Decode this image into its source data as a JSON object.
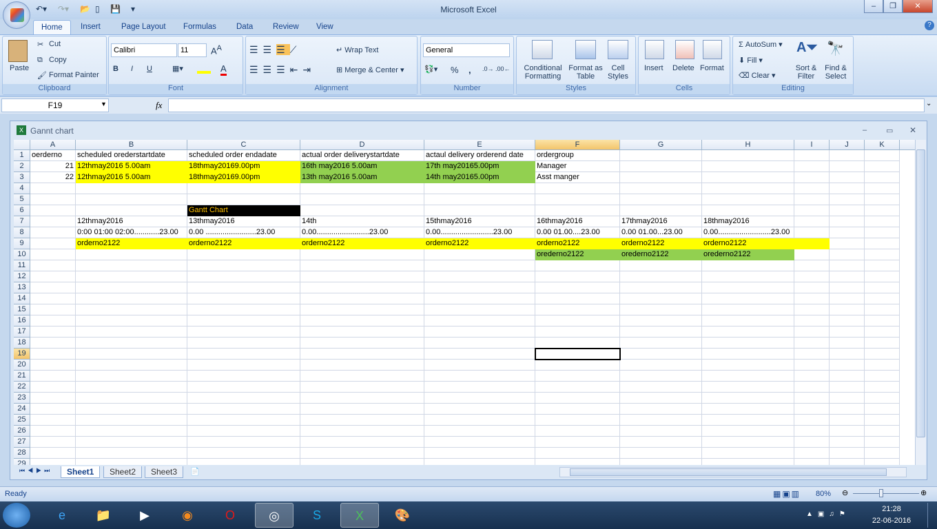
{
  "app": {
    "title": "Microsoft Excel"
  },
  "ribbon": {
    "tabs": [
      "Home",
      "Insert",
      "Page Layout",
      "Formulas",
      "Data",
      "Review",
      "View"
    ],
    "clipboard": {
      "label": "Clipboard",
      "paste": "Paste",
      "cut": "Cut",
      "copy": "Copy",
      "format_painter": "Format Painter"
    },
    "font": {
      "label": "Font",
      "name": "Calibri",
      "size": "11",
      "bold": "B",
      "italic": "I",
      "underline": "U"
    },
    "alignment": {
      "label": "Alignment",
      "wrap": "Wrap Text",
      "merge": "Merge & Center"
    },
    "number": {
      "label": "Number",
      "format": "General",
      "percent": "%",
      "comma": ","
    },
    "styles": {
      "label": "Styles",
      "conditional": "Conditional Formatting",
      "format_table": "Format as Table",
      "cell_styles": "Cell Styles"
    },
    "cells": {
      "label": "Cells",
      "insert": "Insert",
      "delete": "Delete",
      "format": "Format"
    },
    "editing": {
      "label": "Editing",
      "autosum": "AutoSum",
      "fill": "Fill",
      "clear": "Clear",
      "sort": "Sort & Filter",
      "find": "Find & Select"
    }
  },
  "formula_bar": {
    "name_box": "F19",
    "fx": "fx",
    "value": ""
  },
  "workbook": {
    "title": "Gannt chart"
  },
  "colors": {
    "yellow": "#ffff00",
    "green": "#92d050",
    "black": "#000000",
    "orange_text": "#ffc000"
  },
  "columns": [
    "A",
    "B",
    "C",
    "D",
    "E",
    "F",
    "G",
    "H",
    "I",
    "J",
    "K"
  ],
  "row_count": 29,
  "selected_cell": {
    "col": "F",
    "row": 19
  },
  "cells": [
    {
      "r": 1,
      "c": "A",
      "v": "oerderno"
    },
    {
      "r": 1,
      "c": "B",
      "v": "scheduled orederstartdate"
    },
    {
      "r": 1,
      "c": "C",
      "v": "scheduled order endadate"
    },
    {
      "r": 1,
      "c": "D",
      "v": "actual order deliverystartdate"
    },
    {
      "r": 1,
      "c": "E",
      "v": "actaul delivery orderend date"
    },
    {
      "r": 1,
      "c": "F",
      "v": "ordergroup"
    },
    {
      "r": 2,
      "c": "A",
      "v": "21",
      "num": true
    },
    {
      "r": 2,
      "c": "B",
      "v": "12thmay2016 5.00am",
      "fill": "yellow"
    },
    {
      "r": 2,
      "c": "C",
      "v": "18thmay20169.00pm",
      "fill": "yellow"
    },
    {
      "r": 2,
      "c": "D",
      "v": "16th may2016 5.00am",
      "fill": "green"
    },
    {
      "r": 2,
      "c": "E",
      "v": "17th may20165.00pm",
      "fill": "green"
    },
    {
      "r": 2,
      "c": "F",
      "v": "Manager"
    },
    {
      "r": 3,
      "c": "A",
      "v": "22",
      "num": true
    },
    {
      "r": 3,
      "c": "B",
      "v": "12thmay2016 5.00am",
      "fill": "yellow"
    },
    {
      "r": 3,
      "c": "C",
      "v": "18thmay20169.00pm",
      "fill": "yellow"
    },
    {
      "r": 3,
      "c": "D",
      "v": "13th may2016 5.00am",
      "fill": "green"
    },
    {
      "r": 3,
      "c": "E",
      "v": "14th may20165.00pm",
      "fill": "green"
    },
    {
      "r": 3,
      "c": "F",
      "v": "Asst manger"
    },
    {
      "r": 6,
      "c": "C",
      "v": "Gantt Chart",
      "fill": "black",
      "color": "orange_text"
    },
    {
      "r": 7,
      "c": "B",
      "v": "12thmay2016"
    },
    {
      "r": 7,
      "c": "C",
      "v": "13thmay2016"
    },
    {
      "r": 7,
      "c": "D",
      "v": "14th"
    },
    {
      "r": 7,
      "c": "E",
      "v": "15thmay2016"
    },
    {
      "r": 7,
      "c": "F",
      "v": "16thmay2016"
    },
    {
      "r": 7,
      "c": "G",
      "v": "17thmay2016"
    },
    {
      "r": 7,
      "c": "H",
      "v": "18thmay2016"
    },
    {
      "r": 8,
      "c": "B",
      "v": "0:00  01:00  02:00............23.00"
    },
    {
      "r": 8,
      "c": "C",
      "v": "0.00    ........................23.00"
    },
    {
      "r": 8,
      "c": "D",
      "v": "0.00.........................23.00"
    },
    {
      "r": 8,
      "c": "E",
      "v": "0.00.........................23.00"
    },
    {
      "r": 8,
      "c": "F",
      "v": "0.00 01.00....23.00"
    },
    {
      "r": 8,
      "c": "G",
      "v": "0.00 01.00...23.00"
    },
    {
      "r": 8,
      "c": "H",
      "v": "0.00.........................23.00"
    },
    {
      "r": 9,
      "c": "A",
      "v": "",
      "fill": "none"
    },
    {
      "r": 9,
      "c": "B",
      "v": "orderno2122",
      "fill": "yellow"
    },
    {
      "r": 9,
      "c": "C",
      "v": "orderno2122",
      "fill": "yellow"
    },
    {
      "r": 9,
      "c": "D",
      "v": "orderno2122",
      "fill": "yellow"
    },
    {
      "r": 9,
      "c": "E",
      "v": "orderno2122",
      "fill": "yellow"
    },
    {
      "r": 9,
      "c": "F",
      "v": "orderno2122",
      "fill": "yellow"
    },
    {
      "r": 9,
      "c": "G",
      "v": "orderno2122",
      "fill": "yellow"
    },
    {
      "r": 9,
      "c": "H",
      "v": "orderno2122",
      "fill": "yellow"
    },
    {
      "r": 9,
      "c": "I",
      "v": "",
      "fill": "yellow"
    },
    {
      "r": 10,
      "c": "F",
      "v": "orederno2122",
      "fill": "green"
    },
    {
      "r": 10,
      "c": "G",
      "v": "orederno2122",
      "fill": "green"
    },
    {
      "r": 10,
      "c": "H",
      "v": "orederno2122",
      "fill": "green"
    }
  ],
  "sheets": [
    "Sheet1",
    "Sheet2",
    "Sheet3"
  ],
  "active_sheet": "Sheet1",
  "status": {
    "text": "Ready",
    "zoom": "80%"
  },
  "taskbar": {
    "time": "21:28",
    "date": "22-06-2016"
  }
}
